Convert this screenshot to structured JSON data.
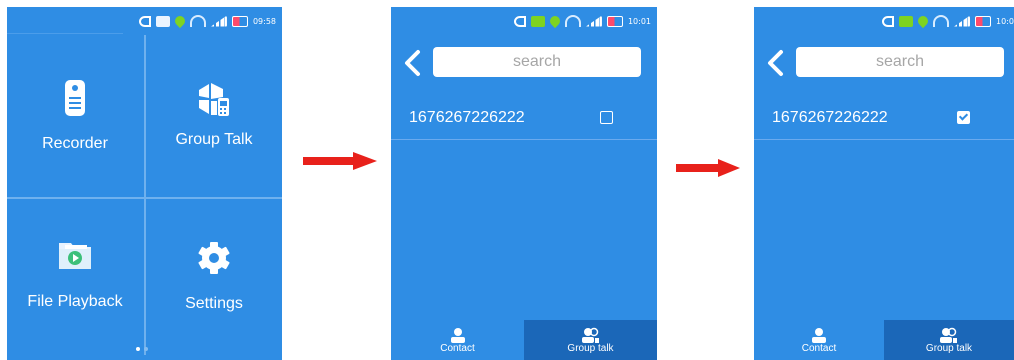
{
  "screen1": {
    "status_time": "09:58",
    "tiles": [
      {
        "label": "Recorder",
        "icon": "recorder-icon"
      },
      {
        "label": "Group Talk",
        "icon": "group-talk-icon"
      },
      {
        "label": "File Playback",
        "icon": "file-playback-icon"
      },
      {
        "label": "Settings",
        "icon": "settings-icon"
      }
    ]
  },
  "screen2": {
    "status_time": "10:01",
    "search_placeholder": "search",
    "contact_number": "1676267226222",
    "checked": false,
    "nav": {
      "contact": "Contact",
      "group_talk": "Group talk",
      "active": "group_talk"
    }
  },
  "screen3": {
    "status_time": "10:0",
    "search_placeholder": "search",
    "contact_number": "1676267226222",
    "checked": true,
    "nav": {
      "contact": "Contact",
      "group_talk": "Group talk",
      "active": "group_talk"
    }
  },
  "colors": {
    "screen_bg": "#2f8de4",
    "nav_active": "#1b67b8",
    "arrow": "#e8211b"
  }
}
